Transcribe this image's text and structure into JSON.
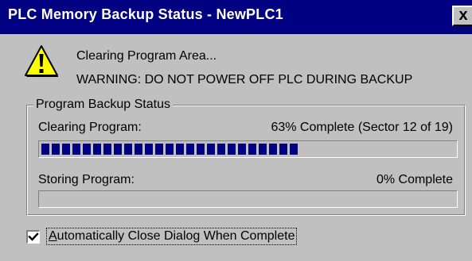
{
  "window": {
    "title": "PLC Memory Backup Status - NewPLC1",
    "close_glyph": "x"
  },
  "message": {
    "icon": "warning-icon",
    "line1": "Clearing Program Area...",
    "line2": "WARNING: DO NOT POWER OFF PLC DURING BACKUP"
  },
  "group": {
    "label": "Program Backup Status",
    "clearing": {
      "label": "Clearing Program:",
      "status": "63% Complete (Sector 12 of 19)",
      "progress_percent": 63
    },
    "storing": {
      "label": "Storing Program:",
      "status": "0% Complete",
      "progress_percent": 0
    }
  },
  "auto_close": {
    "checked": true,
    "accel_letter": "A",
    "label_rest": "utomatically Close Dialog When Complete"
  },
  "colors": {
    "titlebar": "#000080",
    "progress_fill": "#000080",
    "dialog_face": "#c0c0c0"
  }
}
